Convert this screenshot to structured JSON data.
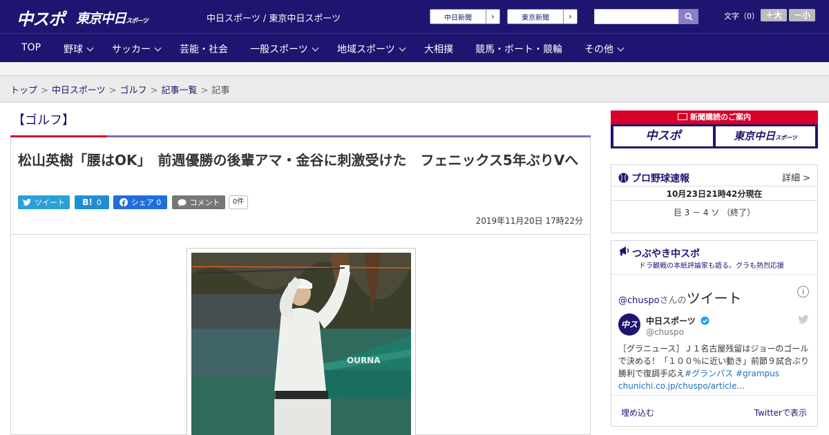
{
  "header": {
    "logo_primary": "中スポ",
    "logo_secondary": "東京中日",
    "logo_secondary_small": "スポーツ",
    "site_names": "中日スポーツ / 東京中日スポーツ",
    "paper_links": [
      {
        "label": "中日新聞",
        "arrow": "›"
      },
      {
        "label": "東京新聞",
        "arrow": "›"
      }
    ],
    "font_size_label": "文字（0）",
    "font_plus": "＋大",
    "font_minus": "－小"
  },
  "nav": [
    {
      "label": "TOP"
    },
    {
      "label": "野球"
    },
    {
      "label": "サッカー"
    },
    {
      "label": "芸能・社会"
    },
    {
      "label": "一般スポーツ"
    },
    {
      "label": "地域スポーツ"
    },
    {
      "label": "大相撲"
    },
    {
      "label": "競馬・ボート・競輪"
    },
    {
      "label": "その他"
    }
  ],
  "breadcrumb": {
    "items": [
      "トップ",
      "中日スポーツ",
      "ゴルフ",
      "記事一覧",
      "記事"
    ],
    "separator": ">"
  },
  "section": {
    "title": "【ゴルフ】"
  },
  "article": {
    "headline": "松山英樹「腰はOK」　前週優勝の後輩アマ・金谷に刺激受けた　フェニックス5年ぶりVへ",
    "share": {
      "tweet": "ツイート",
      "hatena": "0",
      "facebook_label": "シェア",
      "facebook_count": "0",
      "comment": "コメント",
      "comment_count": "0件"
    },
    "date": "2019年11月20日 17時22分"
  },
  "sidebar": {
    "subscription": {
      "title": "新聞購読のご案内",
      "logo_left": "中スポ",
      "logo_right": "東京中日",
      "logo_right_small": "スポーツ"
    },
    "baseball": {
      "title": "プロ野球速報",
      "detail": "詳細 >",
      "timestamp": "10月23日21時42分現在",
      "score": "巨 3 － 4 ソ （終了）"
    },
    "tweets": {
      "title": "つぶやき中スポ",
      "subtitle": "ドラ観戦の本紙評論家も語る。グラも熱烈応援",
      "handle_prefix": "@chuspo",
      "handle_san": "さんの",
      "handle_title": "ツイート",
      "info": "i",
      "account_name": "中日スポーツ",
      "account_id": "@chuspo",
      "avatar_text": "中スポ",
      "tweet_text": "［グラニュース］Ｊ１名古屋残留はジョーのゴールで決める！「１００％に近い動き」前節９試合ぶり勝利で復調手応え",
      "hashtags": "#グランパス #grampus",
      "link": "chunichi.co.jp/chuspo/article…",
      "embed": "埋め込む",
      "view_on_twitter": "Twitterで表示"
    }
  }
}
